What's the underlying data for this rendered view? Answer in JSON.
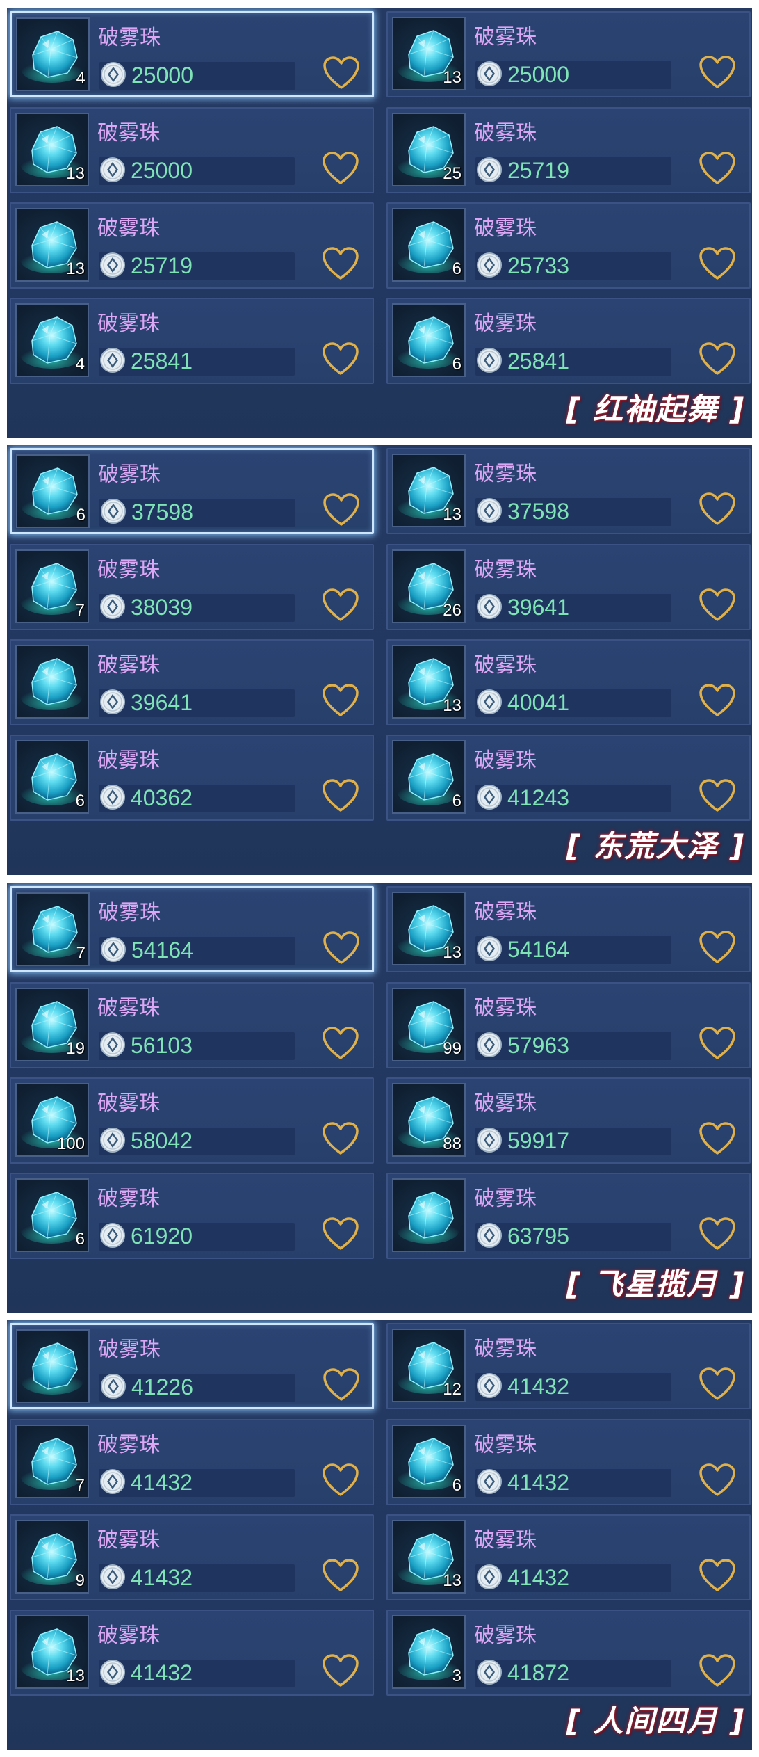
{
  "panels": [
    {
      "title": "[ 红袖起舞 ]",
      "items": [
        {
          "name": "破雾珠",
          "count": "4",
          "price": "25000",
          "selected": true
        },
        {
          "name": "破雾珠",
          "count": "13",
          "price": "25000"
        },
        {
          "name": "破雾珠",
          "count": "13",
          "price": "25000"
        },
        {
          "name": "破雾珠",
          "count": "25",
          "price": "25719"
        },
        {
          "name": "破雾珠",
          "count": "13",
          "price": "25719"
        },
        {
          "name": "破雾珠",
          "count": "6",
          "price": "25733"
        },
        {
          "name": "破雾珠",
          "count": "4",
          "price": "25841"
        },
        {
          "name": "破雾珠",
          "count": "6",
          "price": "25841"
        }
      ]
    },
    {
      "title": "[ 东荒大泽 ]",
      "items": [
        {
          "name": "破雾珠",
          "count": "6",
          "price": "37598",
          "selected": true
        },
        {
          "name": "破雾珠",
          "count": "13",
          "price": "37598"
        },
        {
          "name": "破雾珠",
          "count": "7",
          "price": "38039"
        },
        {
          "name": "破雾珠",
          "count": "26",
          "price": "39641"
        },
        {
          "name": "破雾珠",
          "count": "",
          "price": "39641"
        },
        {
          "name": "破雾珠",
          "count": "13",
          "price": "40041"
        },
        {
          "name": "破雾珠",
          "count": "6",
          "price": "40362"
        },
        {
          "name": "破雾珠",
          "count": "6",
          "price": "41243"
        }
      ]
    },
    {
      "title": "[ 飞星揽月 ]",
      "items": [
        {
          "name": "破雾珠",
          "count": "7",
          "price": "54164",
          "selected": true
        },
        {
          "name": "破雾珠",
          "count": "13",
          "price": "54164"
        },
        {
          "name": "破雾珠",
          "count": "19",
          "price": "56103"
        },
        {
          "name": "破雾珠",
          "count": "99",
          "price": "57963"
        },
        {
          "name": "破雾珠",
          "count": "100",
          "price": "58042"
        },
        {
          "name": "破雾珠",
          "count": "88",
          "price": "59917"
        },
        {
          "name": "破雾珠",
          "count": "6",
          "price": "61920"
        },
        {
          "name": "破雾珠",
          "count": "",
          "price": "63795"
        }
      ]
    },
    {
      "title": "[ 人间四月 ]",
      "items": [
        {
          "name": "破雾珠",
          "count": "",
          "price": "41226",
          "selected": true
        },
        {
          "name": "破雾珠",
          "count": "12",
          "price": "41432"
        },
        {
          "name": "破雾珠",
          "count": "7",
          "price": "41432"
        },
        {
          "name": "破雾珠",
          "count": "6",
          "price": "41432"
        },
        {
          "name": "破雾珠",
          "count": "9",
          "price": "41432"
        },
        {
          "name": "破雾珠",
          "count": "13",
          "price": "41432"
        },
        {
          "name": "破雾珠",
          "count": "13",
          "price": "41432"
        },
        {
          "name": "破雾珠",
          "count": "3",
          "price": "41872"
        }
      ]
    }
  ],
  "icons": {
    "item": "crystal-gem-icon",
    "currency": "coin-icon",
    "favorite": "heart-outline-icon"
  },
  "colors": {
    "panel_bg": "#233a63",
    "name_text": "#dba6f4",
    "price_text": "#7fe3b6",
    "heart_gold": "#e0b04a",
    "selected_glow": "#cfe6ff"
  }
}
